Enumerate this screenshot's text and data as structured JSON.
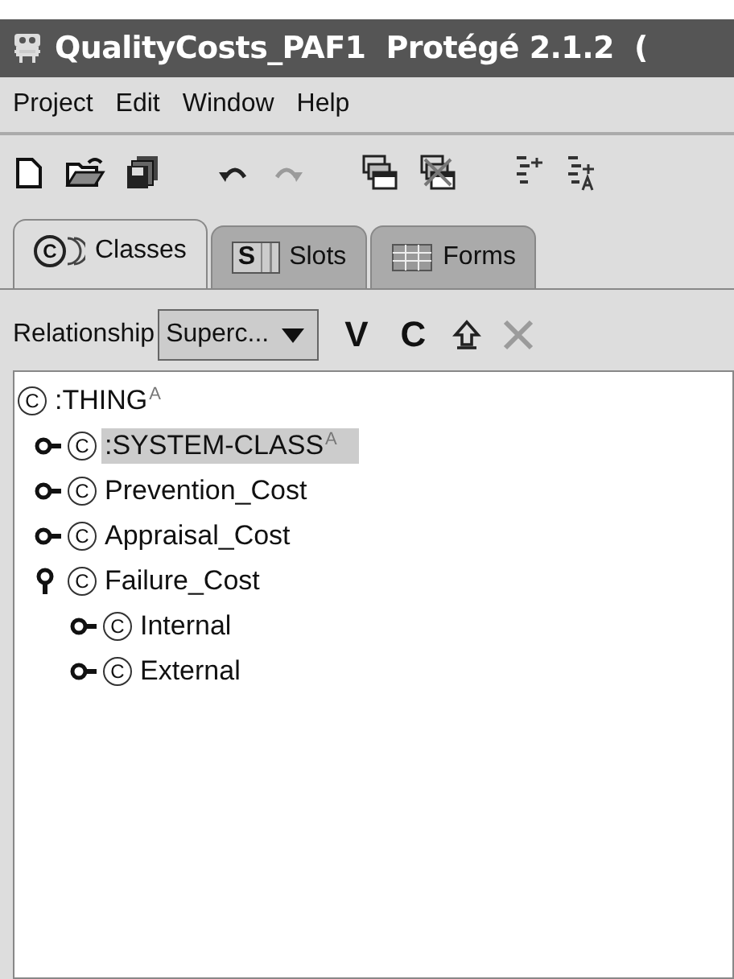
{
  "window": {
    "title": "QualityCosts_PAF1  Protégé 2.1.2  ("
  },
  "menu": [
    "Project",
    "Edit",
    "Window",
    "Help"
  ],
  "toolbar": [
    {
      "kind": "new",
      "disabled": false
    },
    {
      "kind": "open",
      "disabled": false
    },
    {
      "kind": "save",
      "disabled": false
    },
    {
      "kind": "gap"
    },
    {
      "kind": "undo",
      "disabled": false
    },
    {
      "kind": "redo",
      "disabled": true
    },
    {
      "kind": "gap"
    },
    {
      "kind": "windows",
      "disabled": false
    },
    {
      "kind": "windows-x",
      "disabled": false
    },
    {
      "kind": "gap"
    },
    {
      "kind": "tree-add",
      "disabled": false
    },
    {
      "kind": "tree-a",
      "disabled": false
    }
  ],
  "tabs": [
    {
      "label": "Classes",
      "icon": "C",
      "kind": "classes",
      "selected": true
    },
    {
      "label": "Slots",
      "icon": "S",
      "kind": "slots",
      "selected": false
    },
    {
      "label": "Forms",
      "kind": "forms",
      "selected": false
    }
  ],
  "relationship": {
    "label": "Relationship",
    "value": "Superc...",
    "actions": [
      {
        "kind": "text",
        "label": "V",
        "disabled": false
      },
      {
        "kind": "text",
        "label": "C",
        "disabled": false
      },
      {
        "kind": "up",
        "disabled": false
      },
      {
        "kind": "delete",
        "disabled": true
      }
    ]
  },
  "tree": [
    {
      "name": ":THING",
      "icon": "C",
      "superscript": "A",
      "selected": false,
      "children": [
        {
          "name": ":SYSTEM-CLASS",
          "icon": "C",
          "superscript": "A",
          "selected": true,
          "expanded": false
        },
        {
          "name": "Prevention_Cost",
          "icon": "C",
          "selected": false,
          "expanded": false
        },
        {
          "name": "Appraisal_Cost",
          "icon": "C",
          "selected": false,
          "expanded": false
        },
        {
          "name": "Failure_Cost",
          "icon": "C",
          "selected": false,
          "expanded": true,
          "children": [
            {
              "name": "Internal",
              "icon": "C",
              "selected": false,
              "expanded": false
            },
            {
              "name": "External",
              "icon": "C",
              "selected": false,
              "expanded": false
            }
          ]
        }
      ]
    }
  ]
}
